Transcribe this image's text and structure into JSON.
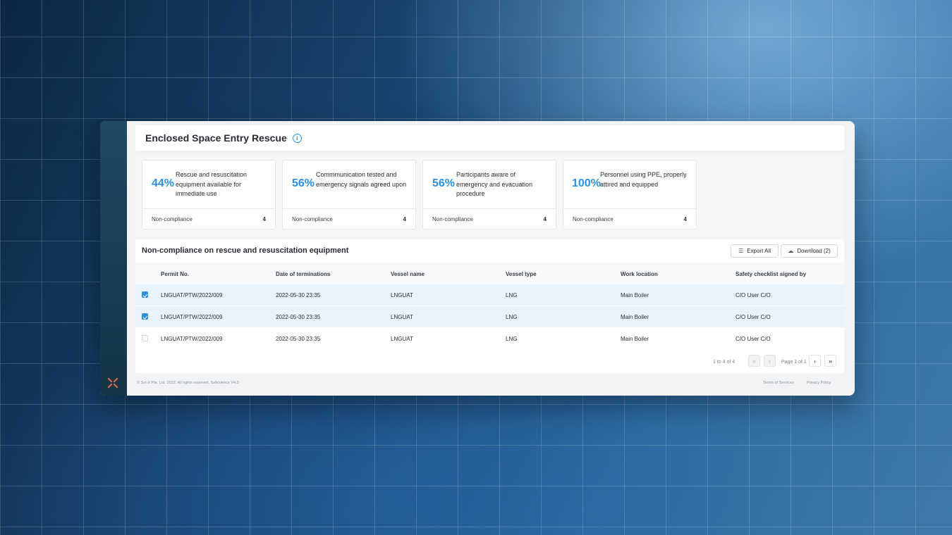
{
  "page": {
    "title": "Enclosed Space Entry Rescue"
  },
  "stats": [
    {
      "percent": "44%",
      "description": "Rescue and resuscitation equipment available for immediate use",
      "footer_label": "Non-compliance",
      "count": "4"
    },
    {
      "percent": "56%",
      "description": "Commmunication tested and emergency signals agreed upon",
      "footer_label": "Non-compliance",
      "count": "4"
    },
    {
      "percent": "56%",
      "description": "Participants aware of emergency and evacuation procedure",
      "footer_label": "Non-compliance",
      "count": "4"
    },
    {
      "percent": "100%",
      "description": "Personnel using PPE, properly attired and equipped",
      "footer_label": "Non-compliance",
      "count": "4"
    }
  ],
  "table": {
    "title": "Non-compliance on rescue and resuscitation equipment",
    "export_label": "Export All",
    "download_label": "Download (2)",
    "headers": [
      "Permit No.",
      "Date of terminations",
      "Vessel name",
      "Vessel type",
      "Work location",
      "Safety checklist signed by"
    ],
    "rows": [
      {
        "selected": true,
        "cells": [
          "LNGUAT/PTW/2022/009",
          "2022-05-30 23:35",
          "LNGUAT",
          "LNG",
          "Main Boiler",
          "C/O User C/O"
        ]
      },
      {
        "selected": true,
        "cells": [
          "LNGUAT/PTW/2022/009",
          "2022-05-30 23:35",
          "LNGUAT",
          "LNG",
          "Main Boiler",
          "C/O User C/O"
        ]
      },
      {
        "selected": false,
        "cells": [
          "LNGUAT/PTW/2022/009",
          "2022-05-30 23:35",
          "LNGUAT",
          "LNG",
          "Main Boiler",
          "C/O User C/O"
        ]
      }
    ],
    "pagination": {
      "range": "1 to 4 of 4",
      "page": "Page 1 of 1",
      "first": "«",
      "prev": "‹",
      "next": "›",
      "last": "»"
    }
  },
  "footer": {
    "copyright": "© Sol-X Pte. Ltd. 2022. All rights reserved. Safesience V4.0",
    "terms": "Terms of Services",
    "privacy": "Privacy Policy"
  },
  "colors": {
    "accent": "#2d8fe0",
    "sidebar": "#1e4a63",
    "logo": "#e8634a",
    "selected_row": "#e8f3fb"
  },
  "icons": {
    "title_info": "info-icon",
    "export": "list-icon",
    "download": "cloud-download-icon",
    "logo": "x-logo-icon"
  }
}
